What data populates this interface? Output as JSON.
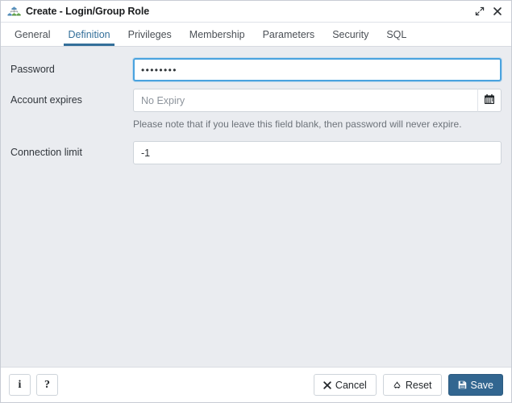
{
  "window": {
    "title": "Create - Login/Group Role",
    "icon": "group-role-icon",
    "controls": [
      {
        "name": "maximize-icon",
        "label": "Maximize"
      },
      {
        "name": "close-icon",
        "label": "Close"
      }
    ]
  },
  "tabs": [
    {
      "label": "General",
      "active": false
    },
    {
      "label": "Definition",
      "active": true
    },
    {
      "label": "Privileges",
      "active": false
    },
    {
      "label": "Membership",
      "active": false
    },
    {
      "label": "Parameters",
      "active": false
    },
    {
      "label": "Security",
      "active": false
    },
    {
      "label": "SQL",
      "active": false
    }
  ],
  "form": {
    "password": {
      "label": "Password",
      "value": "••••••••",
      "placeholder": "",
      "focused": true
    },
    "account_expires": {
      "label": "Account expires",
      "value": "",
      "placeholder": "No Expiry",
      "calendar_icon": "calendar-icon"
    },
    "note": "Please note that if you leave this field blank, then password will never expire.",
    "connection_limit": {
      "label": "Connection limit",
      "value": "-1",
      "placeholder": ""
    }
  },
  "footer": {
    "info_label": "i",
    "help_label": "?",
    "cancel_label": "Cancel",
    "reset_label": "Reset",
    "save_label": "Save"
  },
  "colors": {
    "accent": "#336f9a",
    "primary_button": "#326690",
    "focus_border": "#4aa3df",
    "body_background": "#eaecf0",
    "note_text": "#6d737a"
  }
}
